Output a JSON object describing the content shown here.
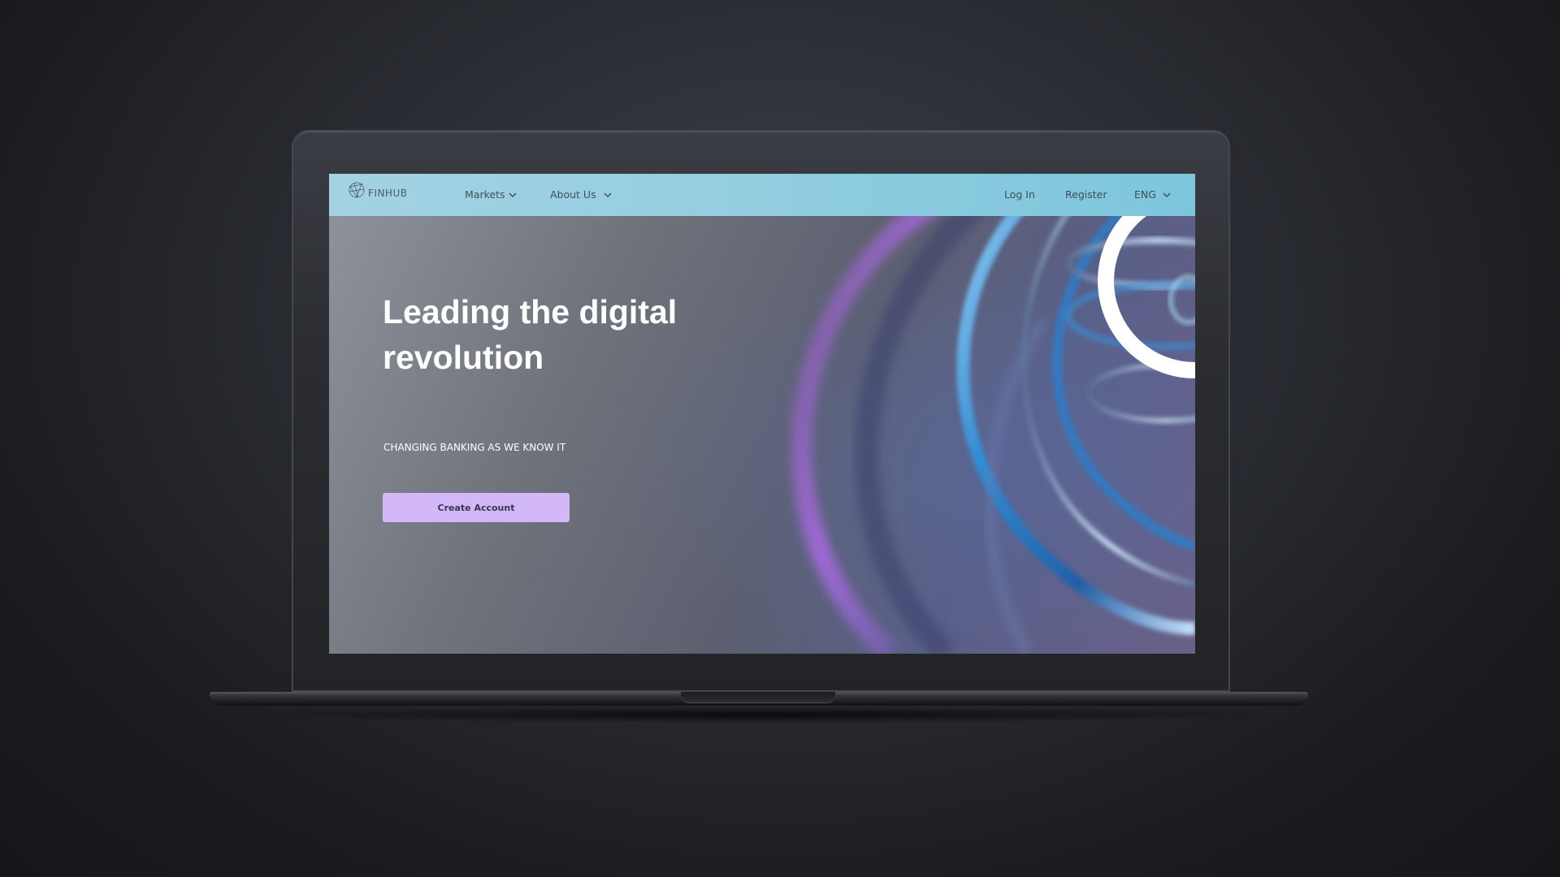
{
  "app": {
    "logo_text": "FINHUB"
  },
  "nav": {
    "items": [
      {
        "label": "Markets",
        "icon": "chevron-down-icon"
      },
      {
        "label": "About Us",
        "icon": "chevron-down-icon"
      }
    ],
    "login_label": "Log In",
    "register_label": "Register",
    "language_label": "ENG"
  },
  "hero": {
    "title": "Leading the digital revolution",
    "subtitle": "CHANGING BANKING AS WE KNOW IT",
    "cta_label": "Create Account"
  },
  "colors": {
    "nav_bg": "#92cde0",
    "cta_bg": "#d2b8f8",
    "accent_blue": "#2f8fd8",
    "accent_purple": "#b46cf0"
  }
}
